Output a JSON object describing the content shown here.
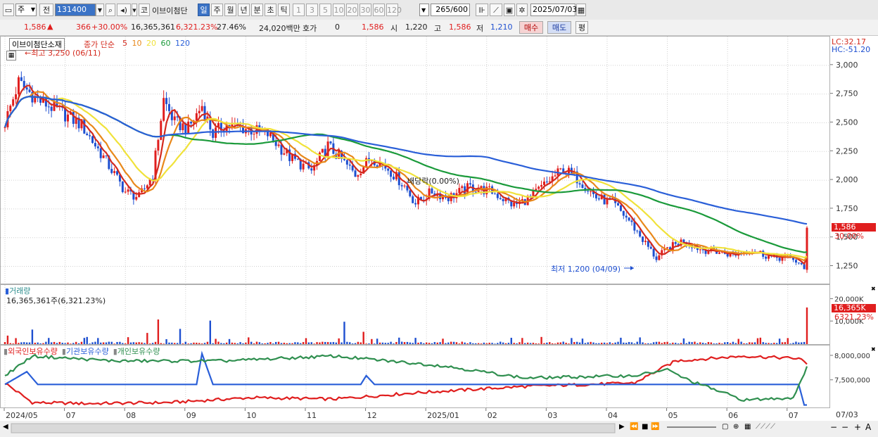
{
  "toolbar": {
    "period_selector": "주",
    "prev_label": "전",
    "code_input": "131400",
    "market_label": "코",
    "stock_name": "이브이첨단",
    "period_buttons": [
      "일",
      "주",
      "월",
      "년",
      "분",
      "초",
      "틱"
    ],
    "period_selected": "일",
    "interval_buttons": [
      "1",
      "3",
      "5",
      "10",
      "20",
      "30",
      "60",
      "120"
    ],
    "count_value": "265",
    "count_max": "/600",
    "date_value": "2025/07/03"
  },
  "quote": {
    "price": "1,586",
    "change": "366",
    "change_pct": "+30.00%",
    "volume": "16,365,361",
    "vol_pct": "6,321.23%",
    "turnover_pct": "27.46%",
    "amount": "24,020백만",
    "hoga_label": "호가",
    "hoga_value": "0",
    "open_value": "1,586",
    "low_label": "시",
    "low_value": "1,220",
    "high_label": "고",
    "high_value": "1,586",
    "bottom_label": "저",
    "bottom_value": "1,210",
    "buy_label": "매수",
    "sell_label": "매도",
    "eval_label": "평"
  },
  "price_panel": {
    "name_label": "이브이첨단소재",
    "ma_label": "종가 단순",
    "ma_periods": [
      "5",
      "10",
      "20",
      "60",
      "120"
    ],
    "ma_colors": [
      "#d42a1e",
      "#e8881a",
      "#f0e23a",
      "#1a9a3a",
      "#2a5fd8"
    ],
    "high_note": "←최고 3,250 (06/11)",
    "low_note": "최저 1,200 (04/09)",
    "div_note": "배당락(0.00%)",
    "lc": "LC:32.17",
    "hc": "HC:-51.20",
    "price_tag": "1,586",
    "pct_tag": "30.00%"
  },
  "volume_panel": {
    "title": "거래량",
    "value": "16,365,361주(6,321.23%)",
    "tag_value": "16,365K",
    "tag_pct": "6321.23%"
  },
  "holding_panel": {
    "legend": [
      "외국인보유수량",
      "기관보유수량",
      "개인보유수량"
    ],
    "colors": [
      "#e01e1e",
      "#2a5fd8",
      "#2f8f4f"
    ]
  },
  "x_axis": {
    "labels": [
      "2024/05",
      "07",
      "08",
      "09",
      "10",
      "11",
      "12",
      "2025/01",
      "02",
      "03",
      "04",
      "05",
      "06",
      "07"
    ],
    "right_label": "07/03"
  },
  "chart_data": [
    {
      "type": "candlestick",
      "title": "",
      "ylim": [
        1100,
        3250
      ],
      "y_ticks": [
        1250,
        1500,
        1750,
        2000,
        2250,
        2500,
        2750,
        3000
      ],
      "x_labels": [
        "2024/05",
        "07",
        "08",
        "09",
        "10",
        "11",
        "12",
        "2025/01",
        "02",
        "03",
        "04",
        "05",
        "06",
        "07"
      ],
      "close_anchors": [
        [
          0,
          2500
        ],
        [
          5,
          2850
        ],
        [
          12,
          2700
        ],
        [
          20,
          2600
        ],
        [
          28,
          2480
        ],
        [
          36,
          2200
        ],
        [
          44,
          1900
        ],
        [
          49,
          1850
        ],
        [
          54,
          2050
        ],
        [
          58,
          2700
        ],
        [
          62,
          2500
        ],
        [
          67,
          2450
        ],
        [
          72,
          2650
        ],
        [
          76,
          2400
        ],
        [
          80,
          2480
        ],
        [
          88,
          2450
        ],
        [
          96,
          2400
        ],
        [
          104,
          2200
        ],
        [
          112,
          2080
        ],
        [
          118,
          2300
        ],
        [
          122,
          2200
        ],
        [
          128,
          2050
        ],
        [
          134,
          2200
        ],
        [
          140,
          2100
        ],
        [
          146,
          1950
        ],
        [
          150,
          1800
        ],
        [
          156,
          1900
        ],
        [
          162,
          1850
        ],
        [
          170,
          1940
        ],
        [
          178,
          1900
        ],
        [
          186,
          1780
        ],
        [
          192,
          1850
        ],
        [
          198,
          1980
        ],
        [
          204,
          2100
        ],
        [
          210,
          2000
        ],
        [
          216,
          1850
        ],
        [
          222,
          1800
        ],
        [
          228,
          1650
        ],
        [
          234,
          1450
        ],
        [
          238,
          1320
        ],
        [
          242,
          1400
        ],
        [
          248,
          1480
        ],
        [
          254,
          1400
        ],
        [
          260,
          1380
        ],
        [
          266,
          1350
        ],
        [
          272,
          1400
        ],
        [
          280,
          1330
        ],
        [
          288,
          1320
        ],
        [
          292,
          1220
        ],
        [
          293,
          1586
        ]
      ],
      "current": 1586,
      "high": {
        "value": 3250,
        "date": "06/11"
      },
      "low": {
        "value": 1200,
        "date": "04/09"
      },
      "moving_averages": [
        "5",
        "10",
        "20",
        "60",
        "120"
      ]
    },
    {
      "type": "bar",
      "title": "거래량",
      "y_ticks": [
        "10,000K",
        "20,000K"
      ],
      "last_value": 16365361,
      "spikes": [
        [
          1,
          3800000
        ],
        [
          10,
          6500000
        ],
        [
          30,
          3200000
        ],
        [
          52,
          5000000
        ],
        [
          56,
          11000000
        ],
        [
          64,
          6800000
        ],
        [
          75,
          10500000
        ],
        [
          124,
          10000000
        ],
        [
          131,
          5500000
        ],
        [
          150,
          2800000
        ],
        [
          196,
          3200000
        ],
        [
          232,
          3000000
        ],
        [
          293,
          16365361
        ]
      ]
    },
    {
      "type": "line",
      "title": "",
      "y_ticks": [
        "7,500,000",
        "8,000,000"
      ],
      "series": [
        {
          "name": "외국인보유수량",
          "anchors": [
            [
              0,
              7450000
            ],
            [
              10,
              7050000
            ],
            [
              30,
              7030000
            ],
            [
              60,
              7050000
            ],
            [
              90,
              7150000
            ],
            [
              120,
              7120000
            ],
            [
              150,
              7250000
            ],
            [
              190,
              7380000
            ],
            [
              230,
              7450000
            ],
            [
              245,
              7900000
            ],
            [
              270,
              8000000
            ],
            [
              290,
              7950000
            ],
            [
              293,
              7850000
            ]
          ]
        },
        {
          "name": "기관보유수량",
          "anchors": [
            [
              0,
              7420000
            ],
            [
              8,
              7680000
            ],
            [
              12,
              7420000
            ],
            [
              70,
              7420000
            ],
            [
              72,
              8050000
            ],
            [
              76,
              7420000
            ],
            [
              130,
              7420000
            ],
            [
              132,
              7600000
            ],
            [
              135,
              7420000
            ],
            [
              290,
              7420000
            ],
            [
              292,
              7000000
            ]
          ]
        },
        {
          "name": "개인보유수량",
          "anchors": [
            [
              0,
              7600000
            ],
            [
              10,
              8000000
            ],
            [
              40,
              7900000
            ],
            [
              80,
              7900000
            ],
            [
              120,
              8000000
            ],
            [
              160,
              7800000
            ],
            [
              190,
              7550000
            ],
            [
              230,
              7600000
            ],
            [
              242,
              7720000
            ],
            [
              250,
              7500000
            ],
            [
              270,
              7100000
            ],
            [
              288,
              7150000
            ],
            [
              293,
              7780000
            ]
          ]
        }
      ]
    }
  ]
}
